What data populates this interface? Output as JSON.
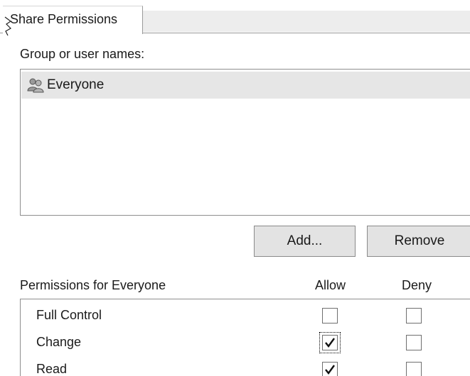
{
  "tabs": [
    {
      "label": "Share Permissions",
      "active": true
    }
  ],
  "group_section": {
    "label": "Group or user names:",
    "items": [
      {
        "name": "Everyone",
        "icon": "users-icon",
        "selected": true
      }
    ]
  },
  "buttons": {
    "add_label": "Add...",
    "remove_label": "Remove"
  },
  "permissions": {
    "header_label": "Permissions for Everyone",
    "allow_label": "Allow",
    "deny_label": "Deny",
    "rows": [
      {
        "name": "Full Control",
        "allow": false,
        "deny": false
      },
      {
        "name": "Change",
        "allow": true,
        "deny": false,
        "focused": true
      },
      {
        "name": "Read",
        "allow": true,
        "deny": false
      }
    ]
  }
}
